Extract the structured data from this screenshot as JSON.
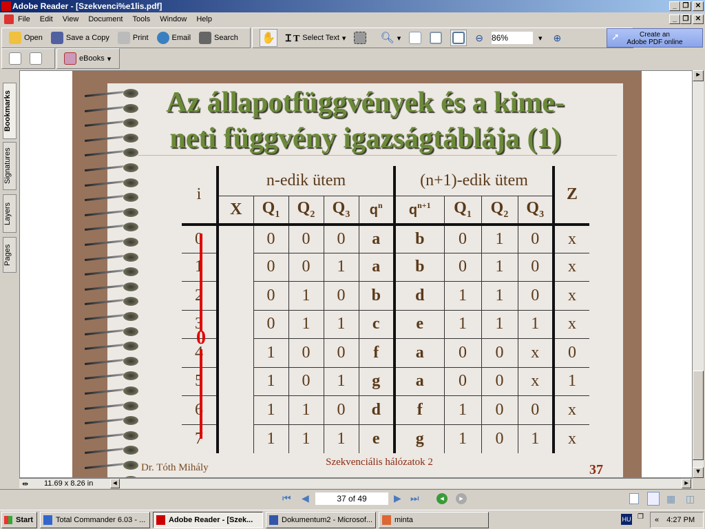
{
  "window": {
    "title": "Adobe Reader - [Szekvenci%e1lis.pdf]"
  },
  "menu": [
    "File",
    "Edit",
    "View",
    "Document",
    "Tools",
    "Window",
    "Help"
  ],
  "toolbar": {
    "open": "Open",
    "save_copy": "Save a Copy",
    "print": "Print",
    "email": "Email",
    "search": "Search",
    "select_text": "Select Text",
    "zoom": "86%",
    "create_pdf_line1": "Create an",
    "create_pdf_line2": "Adobe PDF online",
    "ebooks": "eBooks"
  },
  "nav_tabs": [
    "Bookmarks",
    "Signatures",
    "Layers",
    "Pages"
  ],
  "slide": {
    "title_line1": "Az állapotfüggvények és a kime-",
    "title_line2": "neti függvény igazságtáblája (1)",
    "header": {
      "i": "i",
      "group1": "n-edik ütem",
      "group2": "(n+1)-edik ütem",
      "z": "Z",
      "x": "X",
      "q": "Q",
      "qn": "q",
      "qn_sup": "n",
      "qn1": "q",
      "qn1_sup": "n+1",
      "sub1": "1",
      "sub2": "2",
      "sub3": "3"
    },
    "x_value": "0",
    "rows": [
      [
        "0",
        "0",
        "0",
        "0",
        "a",
        "b",
        "0",
        "1",
        "0",
        "x"
      ],
      [
        "1",
        "0",
        "0",
        "1",
        "a",
        "b",
        "0",
        "1",
        "0",
        "x"
      ],
      [
        "2",
        "0",
        "1",
        "0",
        "b",
        "d",
        "1",
        "1",
        "0",
        "x"
      ],
      [
        "3",
        "0",
        "1",
        "1",
        "c",
        "e",
        "1",
        "1",
        "1",
        "x"
      ],
      [
        "4",
        "1",
        "0",
        "0",
        "f",
        "a",
        "0",
        "0",
        "x",
        "0"
      ],
      [
        "5",
        "1",
        "0",
        "1",
        "g",
        "a",
        "0",
        "0",
        "x",
        "1"
      ],
      [
        "6",
        "1",
        "1",
        "0",
        "d",
        "f",
        "1",
        "0",
        "0",
        "x"
      ],
      [
        "7",
        "1",
        "1",
        "1",
        "e",
        "g",
        "1",
        "0",
        "1",
        "x"
      ]
    ],
    "author": "Dr. Tóth Mihály",
    "course": "Szekvenciális hálózatok 2",
    "page_number": "37",
    "colors": {
      "title": "#6b8a3a",
      "accent_red": "#e00000",
      "footer": "#8b2a10"
    }
  },
  "status": {
    "page_size": "11.69 x 8.26 in",
    "page_field": "37 of 49"
  },
  "taskbar": {
    "start": "Start",
    "tasks": [
      "Total Commander 6.03 - ...",
      "Adobe Reader - [Szek...",
      "Dokumentum2 - Microsof...",
      "minta"
    ],
    "lang": "HU",
    "clock": "4:27 PM"
  }
}
